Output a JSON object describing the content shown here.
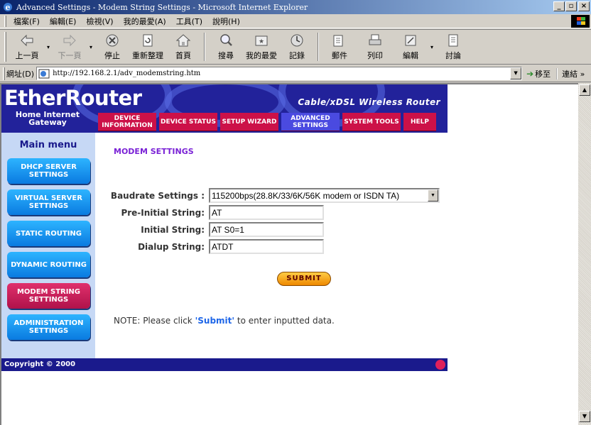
{
  "window": {
    "title": "Advanced Settings - Modem String Settings - Microsoft Internet Explorer",
    "min_label": "_",
    "max_label": "▫",
    "close_label": "×"
  },
  "menu": [
    "檔案(F)",
    "編輯(E)",
    "檢視(V)",
    "我的最愛(A)",
    "工具(T)",
    "說明(H)"
  ],
  "toolbar": {
    "back": "上一頁",
    "forward": "下一頁",
    "stop": "停止",
    "refresh": "重新整理",
    "home": "首頁",
    "search": "搜尋",
    "favorites": "我的最愛",
    "history": "記錄",
    "mail": "郵件",
    "print": "列印",
    "edit": "編輯",
    "discuss": "討論"
  },
  "address": {
    "label": "網址(D)",
    "url": "http://192.168.2.1/adv_modemstring.htm",
    "go": "移至",
    "links": "連結 »"
  },
  "banner": {
    "logo": "EtherRouter",
    "tagline": "Cable/xDSL Wireless Router",
    "subtitle": "Home Internet Gateway"
  },
  "nav_tabs": [
    {
      "label": "DEVICE INFORMATION",
      "active": false
    },
    {
      "label": "DEVICE STATUS",
      "active": false
    },
    {
      "label": "SETUP WIZARD",
      "active": false
    },
    {
      "label": "ADVANCED SETTINGS",
      "active": true
    },
    {
      "label": "SYSTEM TOOLS",
      "active": false
    },
    {
      "label": "HELP",
      "active": false
    }
  ],
  "sidebar": {
    "heading": "Main menu",
    "items": [
      {
        "label": "DHCP SERVER SETTINGS",
        "active": false
      },
      {
        "label": "VIRTUAL SERVER SETTINGS",
        "active": false
      },
      {
        "label": "STATIC ROUTING",
        "active": false
      },
      {
        "label": "DYNAMIC ROUTING",
        "active": false
      },
      {
        "label": "MODEM STRING SETTINGS",
        "active": true
      },
      {
        "label": "ADMINISTRATION SETTINGS",
        "active": false
      }
    ]
  },
  "form": {
    "title": "MODEM SETTINGS",
    "baudrate_label": "Baudrate Settings :",
    "baudrate_value": "115200bps(28.8K/33/6K/56K modem or ISDN TA)",
    "preinit_label": "Pre-Initial String:",
    "preinit_value": "AT",
    "init_label": "Initial String:",
    "init_value": "AT S0=1",
    "dialup_label": "Dialup String:",
    "dialup_value": "ATDT",
    "submit_label": "SUBMIT"
  },
  "note": {
    "prefix": "NOTE: Please click ",
    "highlight": "'Submit'",
    "suffix": " to enter inputted data."
  },
  "footer": {
    "copyright": "Copyright © 2000"
  },
  "colors": {
    "banner": "#22229a",
    "tab_red": "#cc1148",
    "tab_active": "#4a4ae0",
    "sidebar_bg": "#c6d8f5",
    "side_button": "#0a7ae0",
    "side_button_active": "#b0124a",
    "title_purple": "#7a22d6",
    "footer": "#1a1a8c"
  }
}
